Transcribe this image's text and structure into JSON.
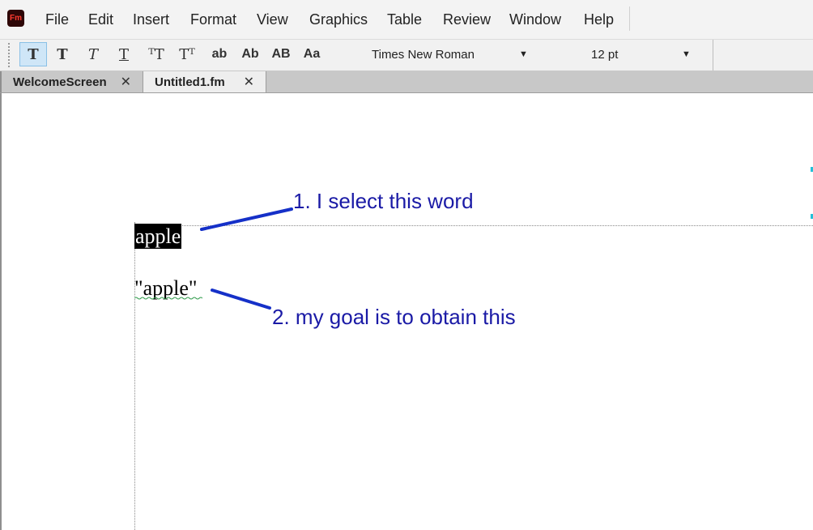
{
  "app": {
    "logo_text": "Fm"
  },
  "menu": [
    "File",
    "Edit",
    "Insert",
    "Format",
    "View",
    "Graphics",
    "Table",
    "Review",
    "Window",
    "Help"
  ],
  "toolbar": {
    "style_buttons": [
      "T",
      "T",
      "T",
      "T",
      "ᵀT",
      "Tᵀ",
      "ab",
      "Ab",
      "AB",
      "Aa"
    ],
    "font_family": "Times New Roman",
    "font_size": "12 pt"
  },
  "tabs": [
    {
      "label": "WelcomeScreen",
      "close": "✕"
    },
    {
      "label": "Untitled1.fm",
      "close": "✕"
    }
  ],
  "document": {
    "selected_word": "apple",
    "goal_text": "\"apple\""
  },
  "annotations": {
    "step1": "1. I select this word",
    "step2": "2. my goal is to obtain this"
  },
  "colors": {
    "annotation": "#1a1aa6",
    "arrow": "#1530c8",
    "selection_bg": "#000000",
    "active_tool": "#cfe6f7"
  }
}
